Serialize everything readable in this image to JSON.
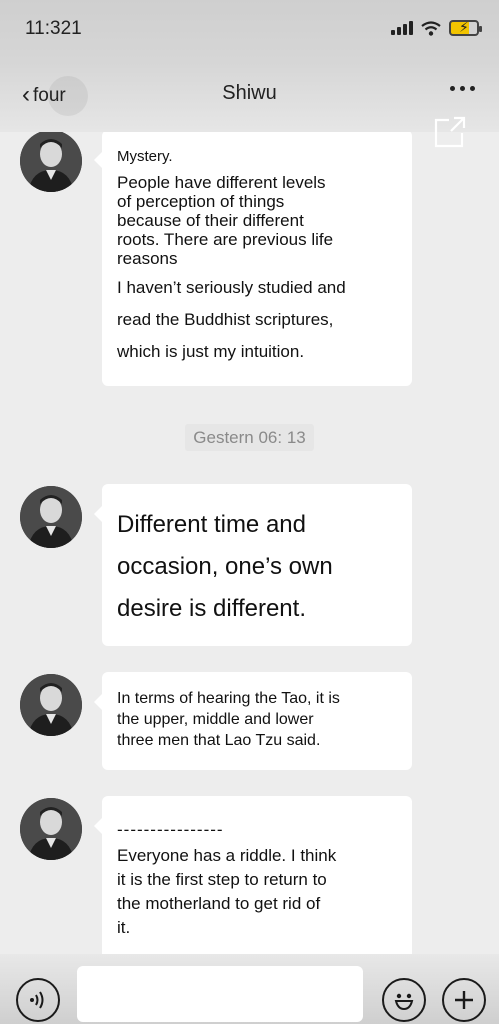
{
  "status": {
    "time": "11:321"
  },
  "nav": {
    "back_label": "four",
    "title": "Shiwu"
  },
  "messages": [
    {
      "lines": [
        "Mystery.",
        "People have different levels",
        "of perception of things",
        "because of their different",
        "roots. There are previous life",
        "reasons",
        "I haven’t seriously studied and",
        "read the Buddhist scriptures,",
        "which is just my intuition."
      ]
    },
    {
      "lines": [
        "Different time and",
        "occasion, one’s own",
        "desire is different."
      ]
    },
    {
      "lines": [
        "In terms of hearing the Tao, it is",
        "the upper, middle and lower",
        "three men that Lao Tzu said."
      ]
    },
    {
      "lines": [
        "----------------",
        "Everyone has a riddle. I think",
        "it is the first step to return to",
        "the motherland to get rid of",
        "it."
      ]
    }
  ],
  "time_divider": "Gestern 06: 13",
  "colors": {
    "battery": "#f2c400",
    "bubble": "#ffffff",
    "background": "#ededed"
  },
  "icons": [
    "signal-icon",
    "wifi-icon",
    "battery-icon",
    "share-icon",
    "voice-icon",
    "emoji-icon",
    "add-icon"
  ]
}
